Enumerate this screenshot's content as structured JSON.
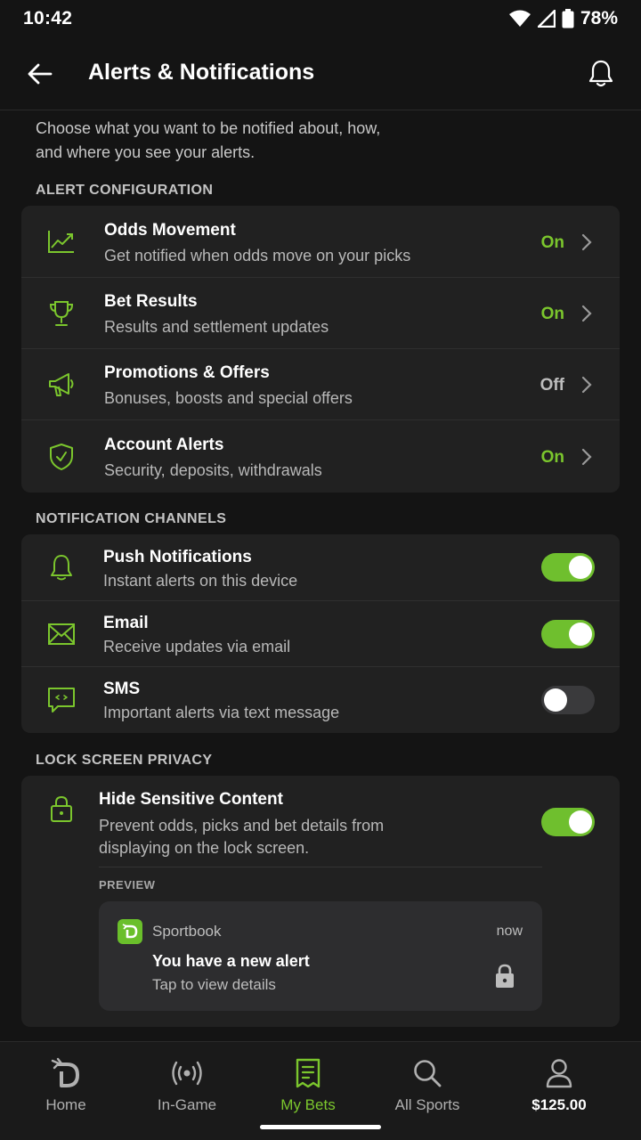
{
  "status_bar": {
    "time": "10:42",
    "battery": "78%"
  },
  "header": {
    "title": "Alerts & Notifications"
  },
  "intro": {
    "line1": "Choose what you want to be notified about, how,",
    "line2": "and where you see your alerts."
  },
  "alert_configuration": {
    "heading": "ALERT CONFIGURATION",
    "items": [
      {
        "title": "Odds Movement",
        "subtitle": "Get notified when odds move on your picks",
        "state": "On",
        "icon": "trending-chart-icon"
      },
      {
        "title": "Bet Results",
        "subtitle": "Results and settlement updates",
        "state": "On",
        "icon": "trophy-icon"
      },
      {
        "title": "Promotions & Offers",
        "subtitle": "Bonuses, boosts and special offers",
        "state": "Off",
        "icon": "megaphone-icon"
      },
      {
        "title": "Account Alerts",
        "subtitle": "Security, deposits, withdrawals",
        "state": "On",
        "icon": "shield-check-icon"
      }
    ]
  },
  "notification_channels": {
    "heading": "NOTIFICATION CHANNELS",
    "items": [
      {
        "title": "Push Notifications",
        "subtitle": "Instant alerts on this device",
        "enabled": true,
        "icon": "bell-icon"
      },
      {
        "title": "Email",
        "subtitle": "Receive updates via email",
        "enabled": true,
        "icon": "mail-icon"
      },
      {
        "title": "SMS",
        "subtitle": "Important alerts via text message",
        "enabled": false,
        "icon": "chat-icon"
      }
    ]
  },
  "lock_screen_privacy": {
    "heading": "LOCK SCREEN PRIVACY",
    "title": "Hide Sensitive Content",
    "subtitle_line1": "Prevent odds, picks and bet details from",
    "subtitle_line2": "displaying on the lock screen.",
    "enabled": true,
    "preview_label": "PREVIEW",
    "preview": {
      "app_name": "Sportbook",
      "time": "now",
      "title": "You have a new alert",
      "subtitle": "Tap to view details"
    }
  },
  "bottom_nav": {
    "items": [
      {
        "label": "Home",
        "icon": "home-logo-icon",
        "active": false
      },
      {
        "label": "In-Game",
        "icon": "live-signal-icon",
        "active": false
      },
      {
        "label": "My Bets",
        "icon": "bet-slip-icon",
        "active": true
      },
      {
        "label": "All Sports",
        "icon": "search-icon",
        "active": false
      },
      {
        "label": "$125.00",
        "icon": "account-icon",
        "active": false
      }
    ]
  },
  "colors": {
    "accent": "#7bc62d",
    "background": "#141414",
    "card": "#212121"
  }
}
